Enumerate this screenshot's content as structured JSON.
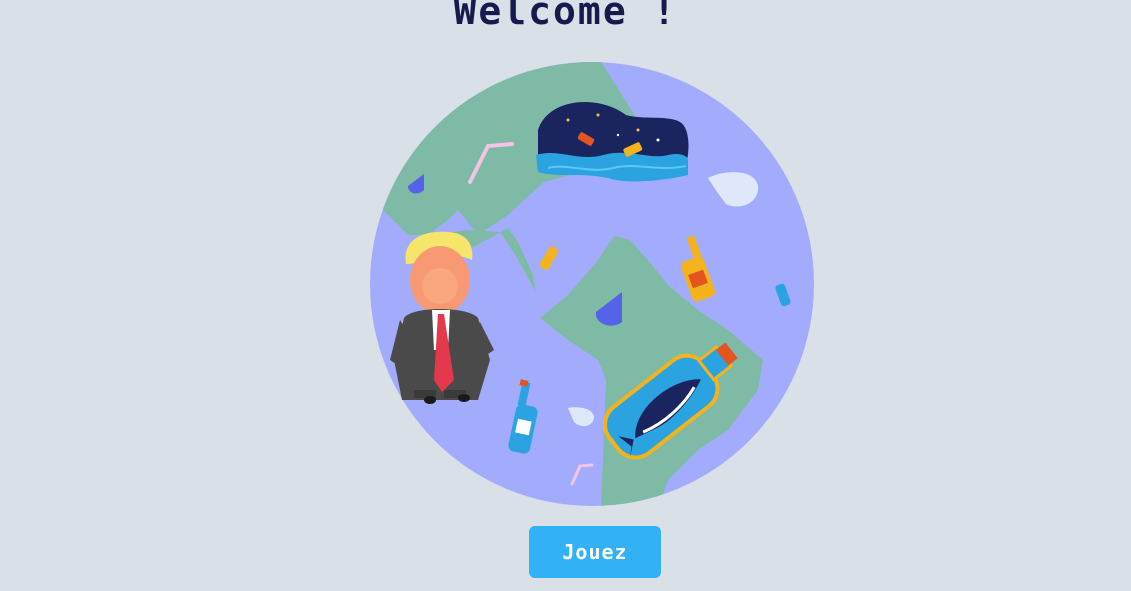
{
  "page": {
    "title": "Welcome !"
  },
  "actions": {
    "play_label": "Jouez"
  },
  "illustration": {
    "subject": "globe",
    "icons": [
      "earth-globe-icon",
      "character-figure-icon",
      "whale-in-bottle-icon",
      "night-sky-wave-icon",
      "bottle-icon",
      "straw-icon",
      "plastic-bag-icon",
      "drop-icon"
    ]
  },
  "colors": {
    "background": "#d9e0e8",
    "title": "#161a4d",
    "ocean": "#a3acfc",
    "land": "#7fbaa6",
    "button": "#32b1f7",
    "button_text": "#ffffff"
  }
}
